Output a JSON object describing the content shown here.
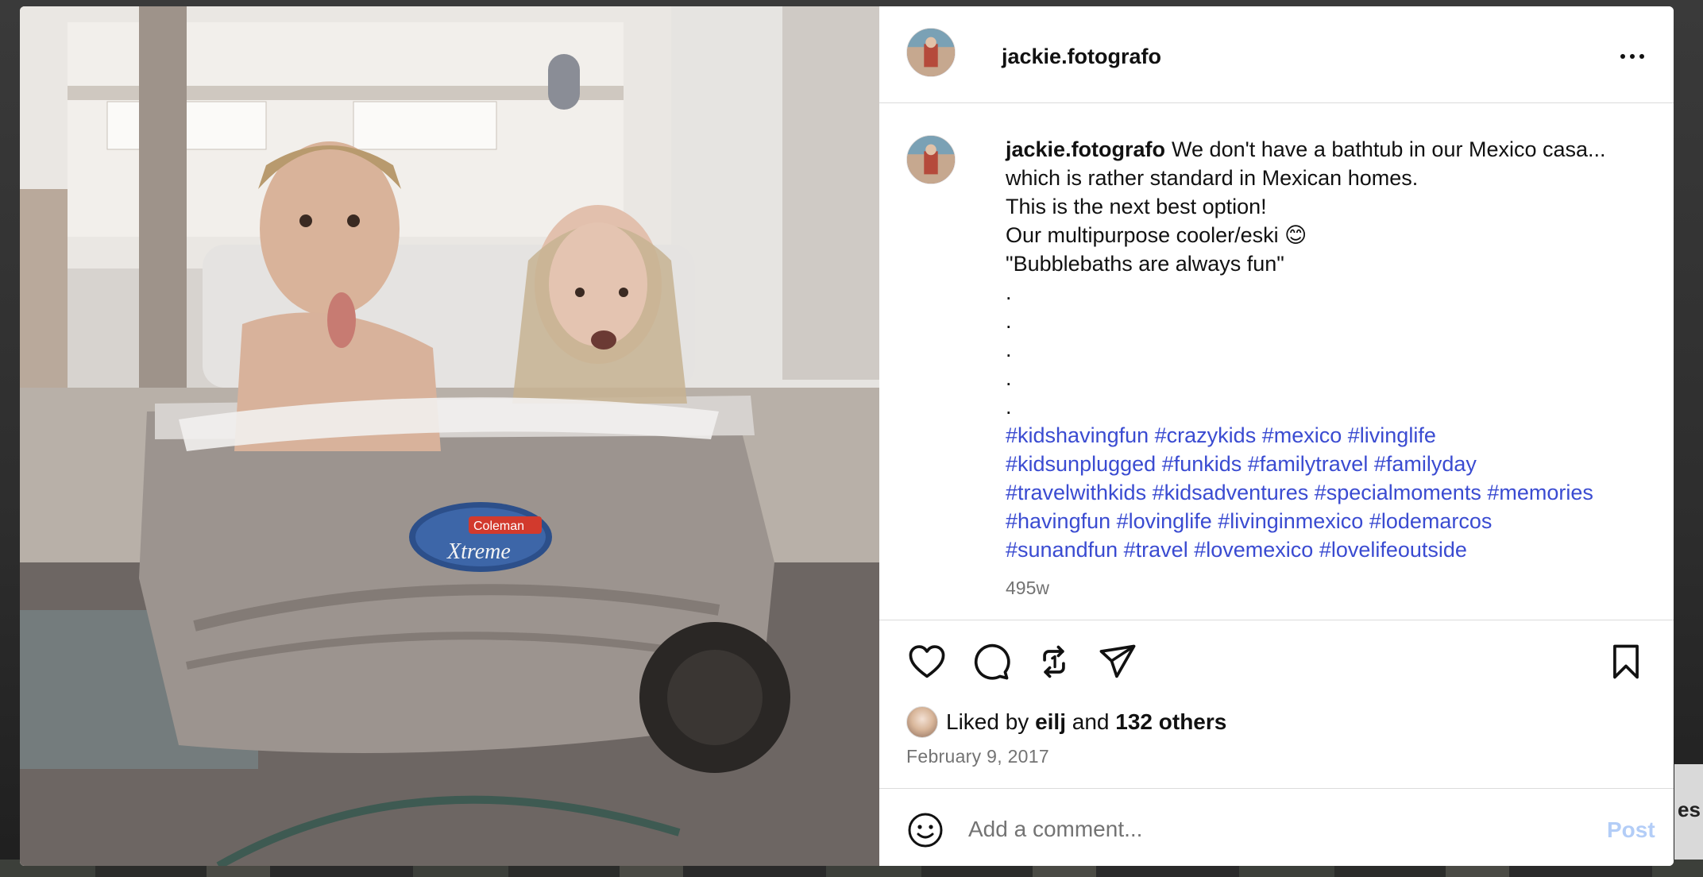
{
  "background": {
    "partial_text": "es"
  },
  "post": {
    "username": "jackie.fotografo",
    "caption": {
      "lines": [
        "We don't have a bathtub in our Mexico casa...",
        "which is rather standard in Mexican homes.",
        "This is the next best option!",
        "Our multipurpose cooler/eski 😊",
        "\"Bubblebaths are always fun\"",
        ".",
        ".",
        ".",
        ".",
        "."
      ],
      "hashtag_lines": [
        [
          "#kidshavingfun",
          "#crazykids",
          "#mexico",
          "#livinglife"
        ],
        [
          "#kidsunplugged",
          "#funkids",
          "#familytravel",
          "#familyday"
        ],
        [
          "#travelwithkids",
          "#kidsadventures",
          "#specialmoments",
          "#memories"
        ],
        [
          "#havingfun",
          "#lovinglife",
          "#livinginmexico",
          "#lodemarcos"
        ],
        [
          "#sunandfun",
          "#travel",
          "#lovemexico",
          "#lovelifeoutside"
        ]
      ],
      "time_ago": "495w"
    },
    "photo": {
      "cooler_brand_top": "Coleman",
      "cooler_brand_bottom": "Xtreme"
    },
    "likes": {
      "prefix": "Liked by",
      "user": "eilj",
      "joiner": "and",
      "others": "132 others"
    },
    "date": "February 9, 2017"
  },
  "comment": {
    "placeholder": "Add a comment...",
    "post_label": "Post"
  },
  "colors": {
    "hashtag": "#3a4bd1",
    "post_button_disabled": "#b3cdf7",
    "muted_text": "#737373",
    "divider": "#dbdbdb"
  }
}
